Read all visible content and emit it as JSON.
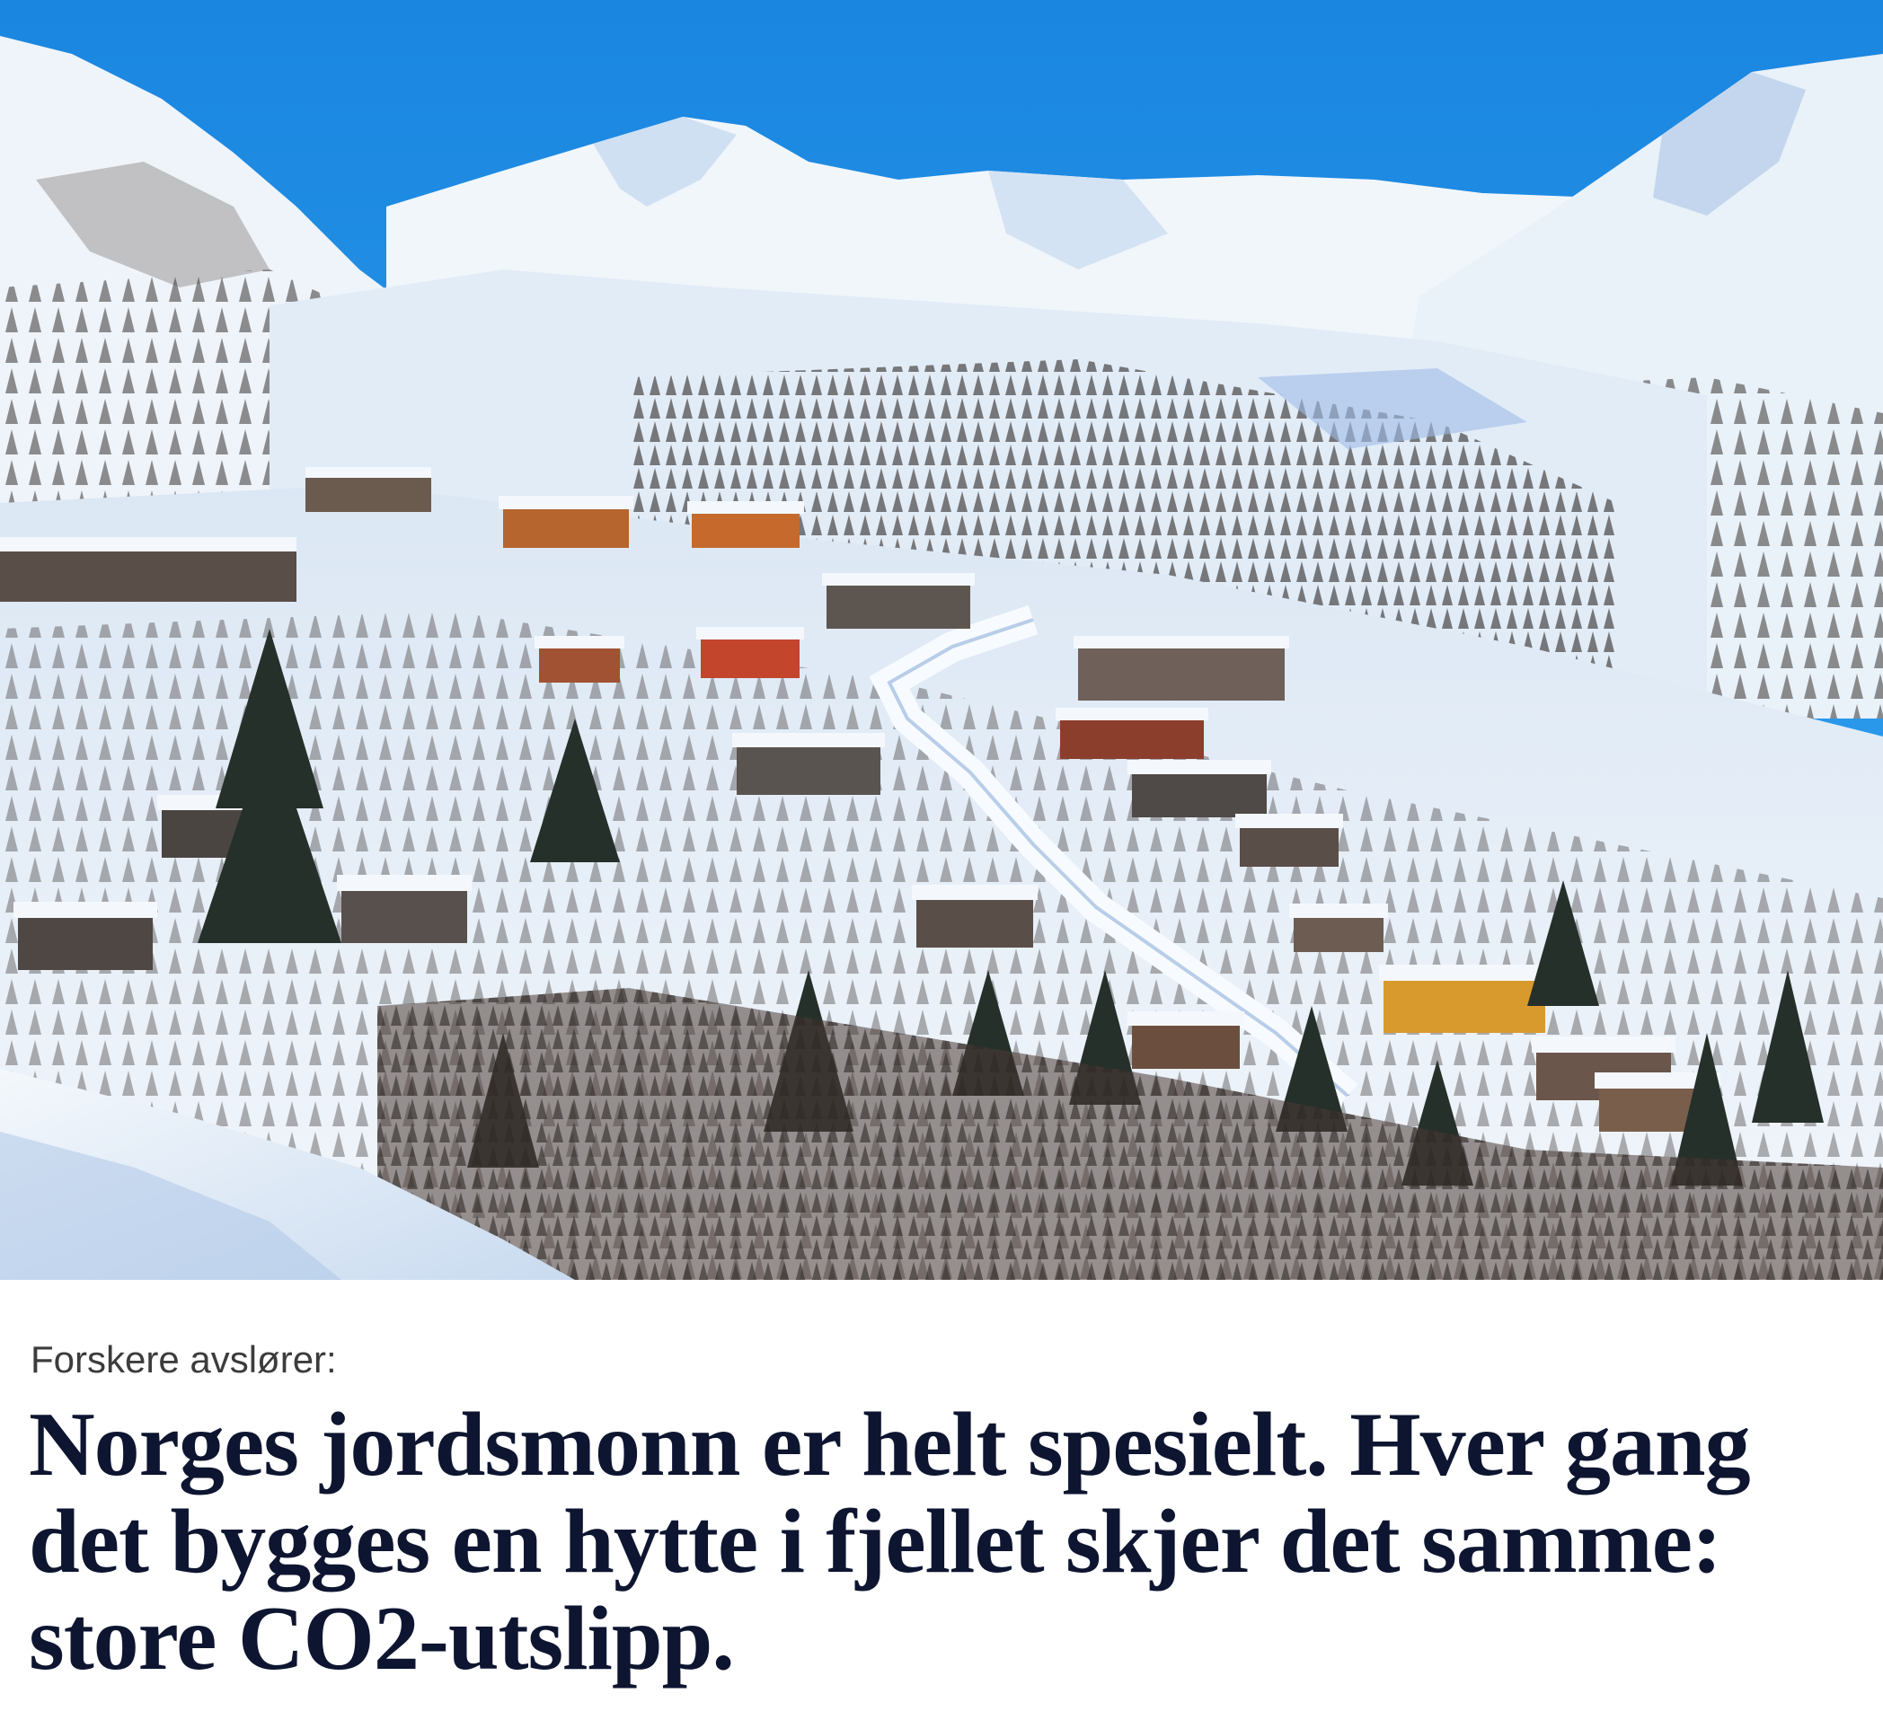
{
  "article": {
    "image_icon": "photo-mountain-cabin-village-icon",
    "kicker": "Forskere avslører:",
    "headline": "Norges jordsmonn er helt spesielt. Hver gang det bygges en hytte i fjellet skjer det samme: store CO2-utslipp."
  },
  "colors": {
    "sky": "#1f8fe6",
    "snow": "#eef4fb",
    "shadow_snow": "#7aa6dd",
    "headline": "#0d1530",
    "kicker": "#3c3c3c"
  }
}
